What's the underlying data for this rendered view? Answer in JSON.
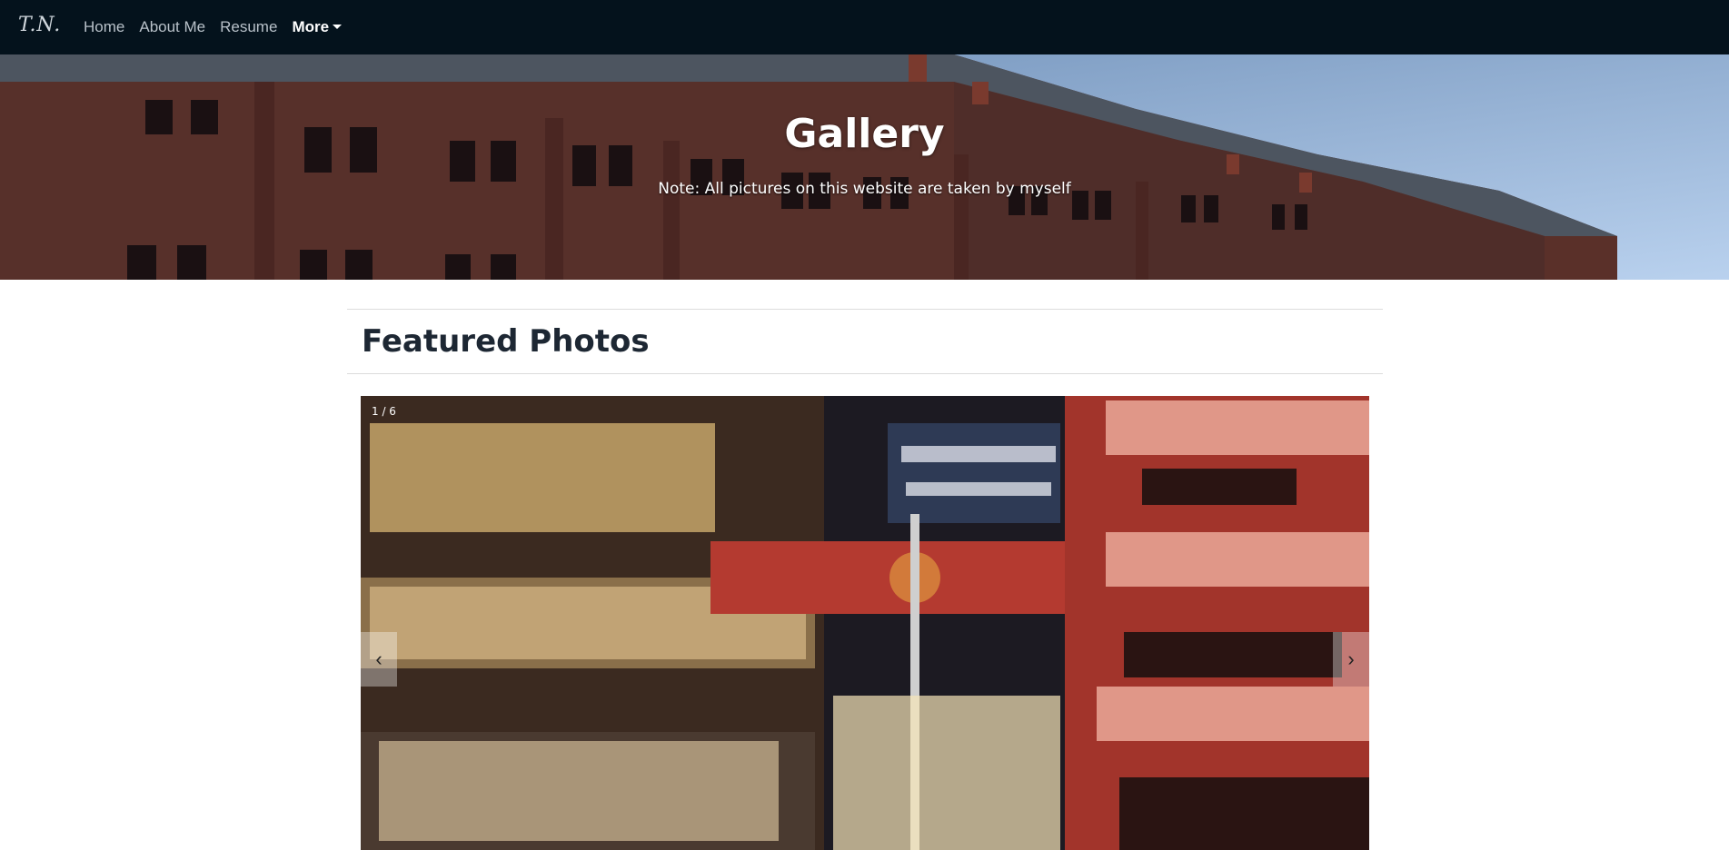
{
  "navbar": {
    "brand": "T.N.",
    "links": [
      "Home",
      "About Me",
      "Resume"
    ],
    "more_label": "More"
  },
  "hero": {
    "title": "Gallery",
    "note": "Note: All pictures on this website are taken by myself"
  },
  "featured": {
    "title": "Featured Photos",
    "counter": "1 / 6",
    "prev_icon": "‹",
    "next_icon": "›"
  },
  "colors": {
    "navbar_bg": "#04121c",
    "text_dark": "#1d2733"
  },
  "icons": {
    "prev": "chevron-left-icon",
    "next": "chevron-right-icon"
  }
}
